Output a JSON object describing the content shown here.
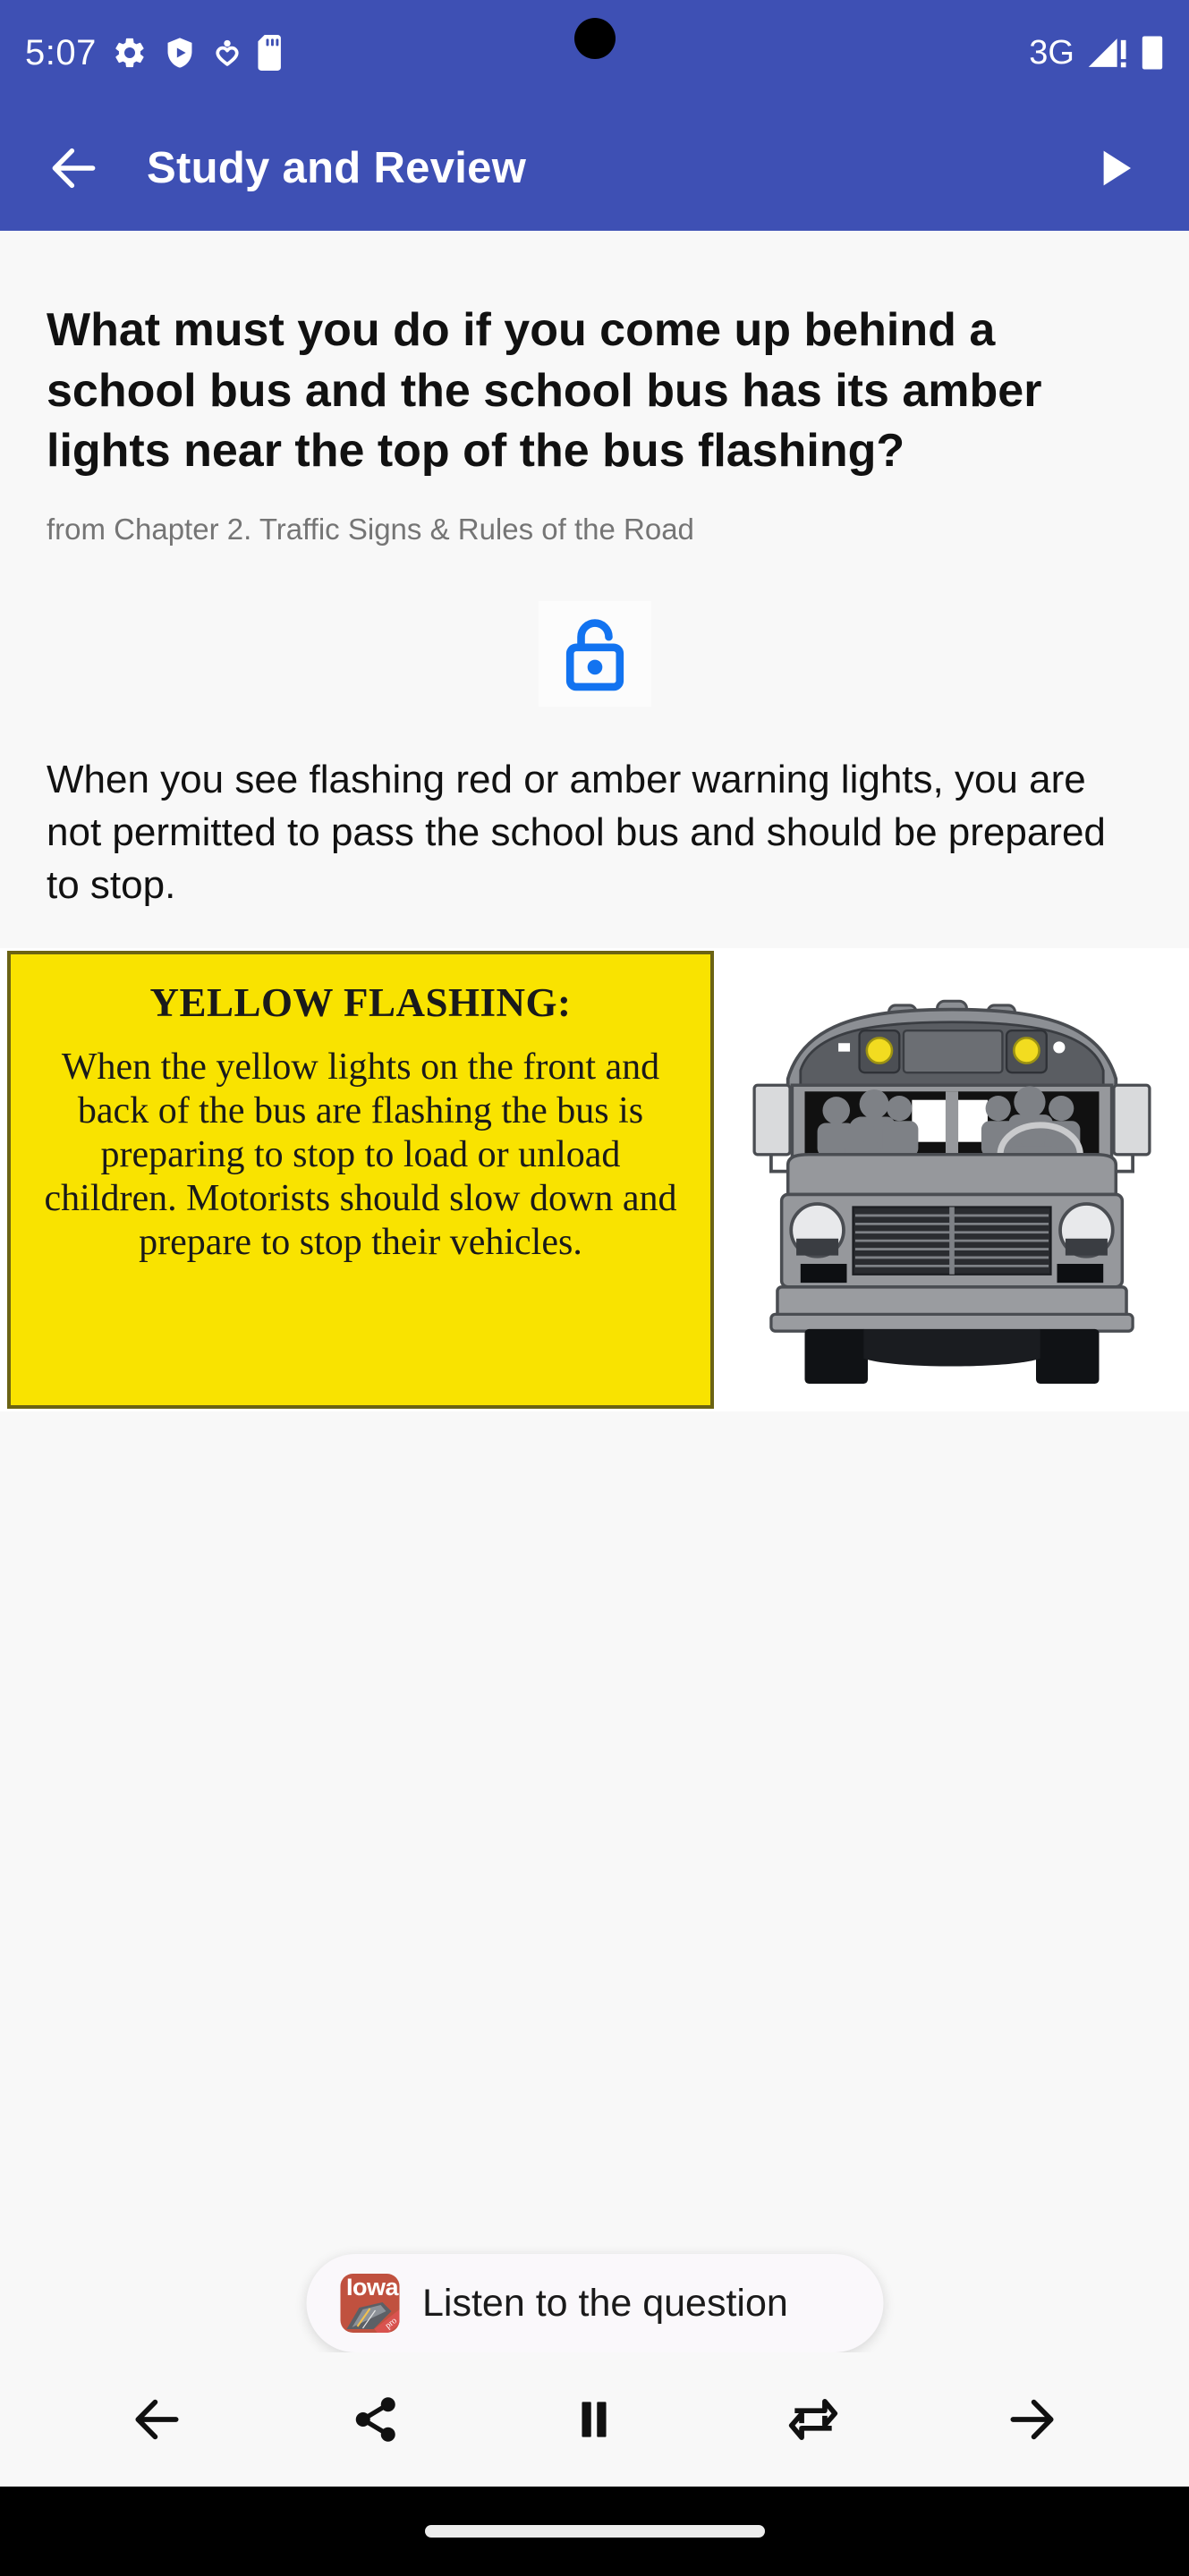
{
  "status_bar": {
    "time": "5:07",
    "network": "3G",
    "icons": [
      "gear-icon",
      "shield-play-icon",
      "person-heart-icon",
      "sd-card-icon"
    ],
    "right_icons": [
      "signal-icon",
      "battery-icon"
    ]
  },
  "app_bar": {
    "title": "Study and Review",
    "back_label": "Back",
    "play_label": "Play"
  },
  "question": {
    "text": "What must you do if you come up behind a school bus and the school bus has its amber lights near the top of the bus flashing?",
    "source": "from Chapter 2. Traffic Signs & Rules of the Road"
  },
  "answer": {
    "lock_icon": "unlock-icon",
    "text": "When you see flashing red or amber warning lights, you are not permitted to pass the school bus and should be prepared to stop."
  },
  "illustration": {
    "sign_title": "YELLOW FLASHING:",
    "sign_body": "When the yellow lights on the front and back of the bus are flashing the bus is preparing to stop to load or unload children. Motorists should slow down and prepare to stop their vehicles.",
    "bus_alt": "Front view of a school bus with amber warning lights"
  },
  "toast": {
    "app_icon_label": "Iowa",
    "app_icon_badge": "pro",
    "message": "Listen to the question"
  },
  "bottom_bar": {
    "buttons": [
      {
        "name": "previous-button",
        "icon": "arrow-left-icon"
      },
      {
        "name": "share-button",
        "icon": "share-icon"
      },
      {
        "name": "pause-button",
        "icon": "pause-icon"
      },
      {
        "name": "repeat-button",
        "icon": "repeat-icon"
      },
      {
        "name": "next-button",
        "icon": "arrow-right-icon"
      }
    ]
  },
  "colors": {
    "primary": "#3e50b4",
    "accent": "#1a73e8",
    "sign_yellow": "#f9e300",
    "background": "#f8f8f8",
    "app_icon": "#c0513f"
  }
}
